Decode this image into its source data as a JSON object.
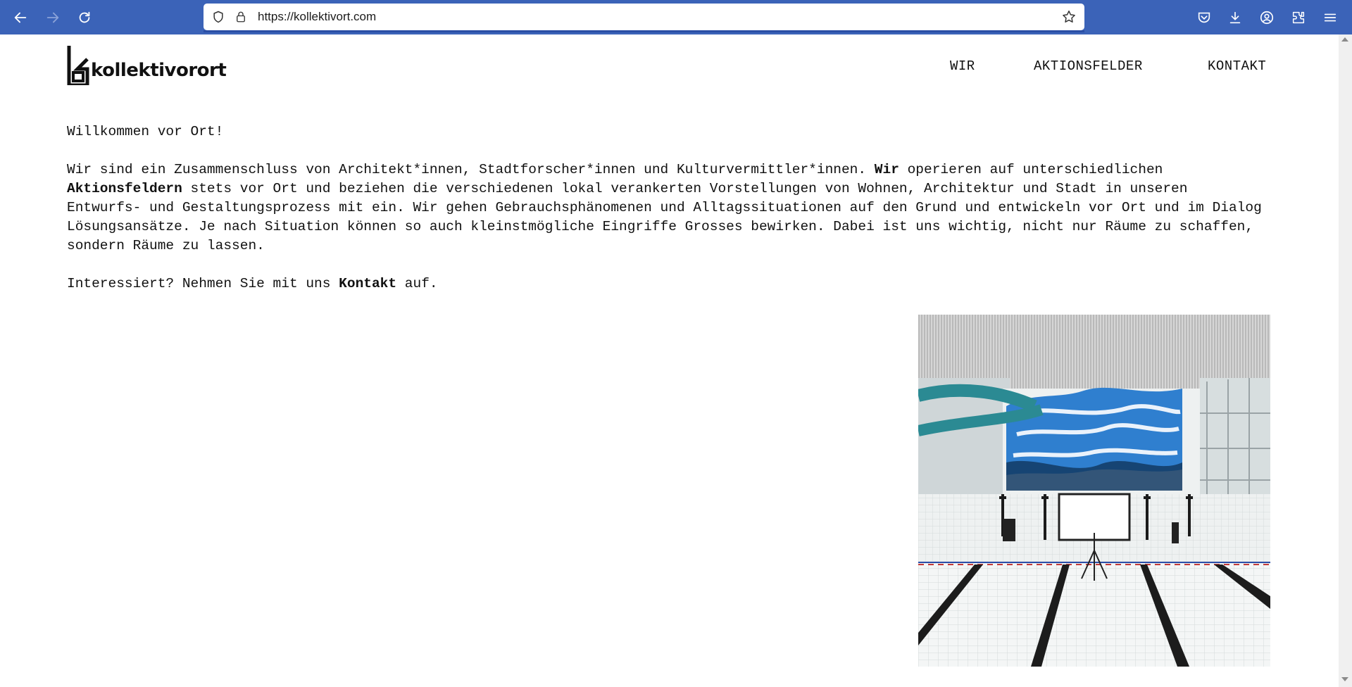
{
  "browser": {
    "url": "https://kollektivort.com",
    "icons": [
      "back-icon",
      "forward-icon",
      "reload-icon",
      "shield-icon",
      "lock-icon",
      "star-icon",
      "pocket-icon",
      "download-icon",
      "account-icon",
      "extensions-icon",
      "menu-icon"
    ]
  },
  "site": {
    "logo_text": "kollektivorort",
    "nav": [
      "WIR",
      "AKTIONSFELDER",
      "KONTAKT"
    ]
  },
  "intro": {
    "greeting": "Willkommen vor Ort!",
    "p1_part1": "Wir sind ein Zusammenschluss von Architekt*innen, Stadtforscher*innen und Kulturvermittler*innen. ",
    "p1_link1": "Wir",
    "p1_part2": " operieren auf unterschiedlichen ",
    "p1_link2": "Aktionsfeldern",
    "p1_part3": " stets vor Ort und beziehen die verschiedenen lokal verankerten Vorstellungen von Wohnen, Architektur und Stadt in unseren Entwurfs- und Gestaltungsprozess mit ein. Wir gehen Gebrauchsphänomenen und Alltagssituationen auf den Grund und entwickeln vor Ort und im Dialog Lösungsansätze. Je nach Situation können so auch kleinstmögliche Eingriffe Grosses bewirken. Dabei ist uns wichtig, nicht nur Räume zu schaffen, sondern Räume zu lassen.",
    "p2_part1": "Interessiert? Nehmen Sie mit uns ",
    "p2_link": "Kontakt",
    "p2_part2": " auf."
  },
  "colors": {
    "toolbar": "#3b63b8",
    "text": "#111111"
  }
}
